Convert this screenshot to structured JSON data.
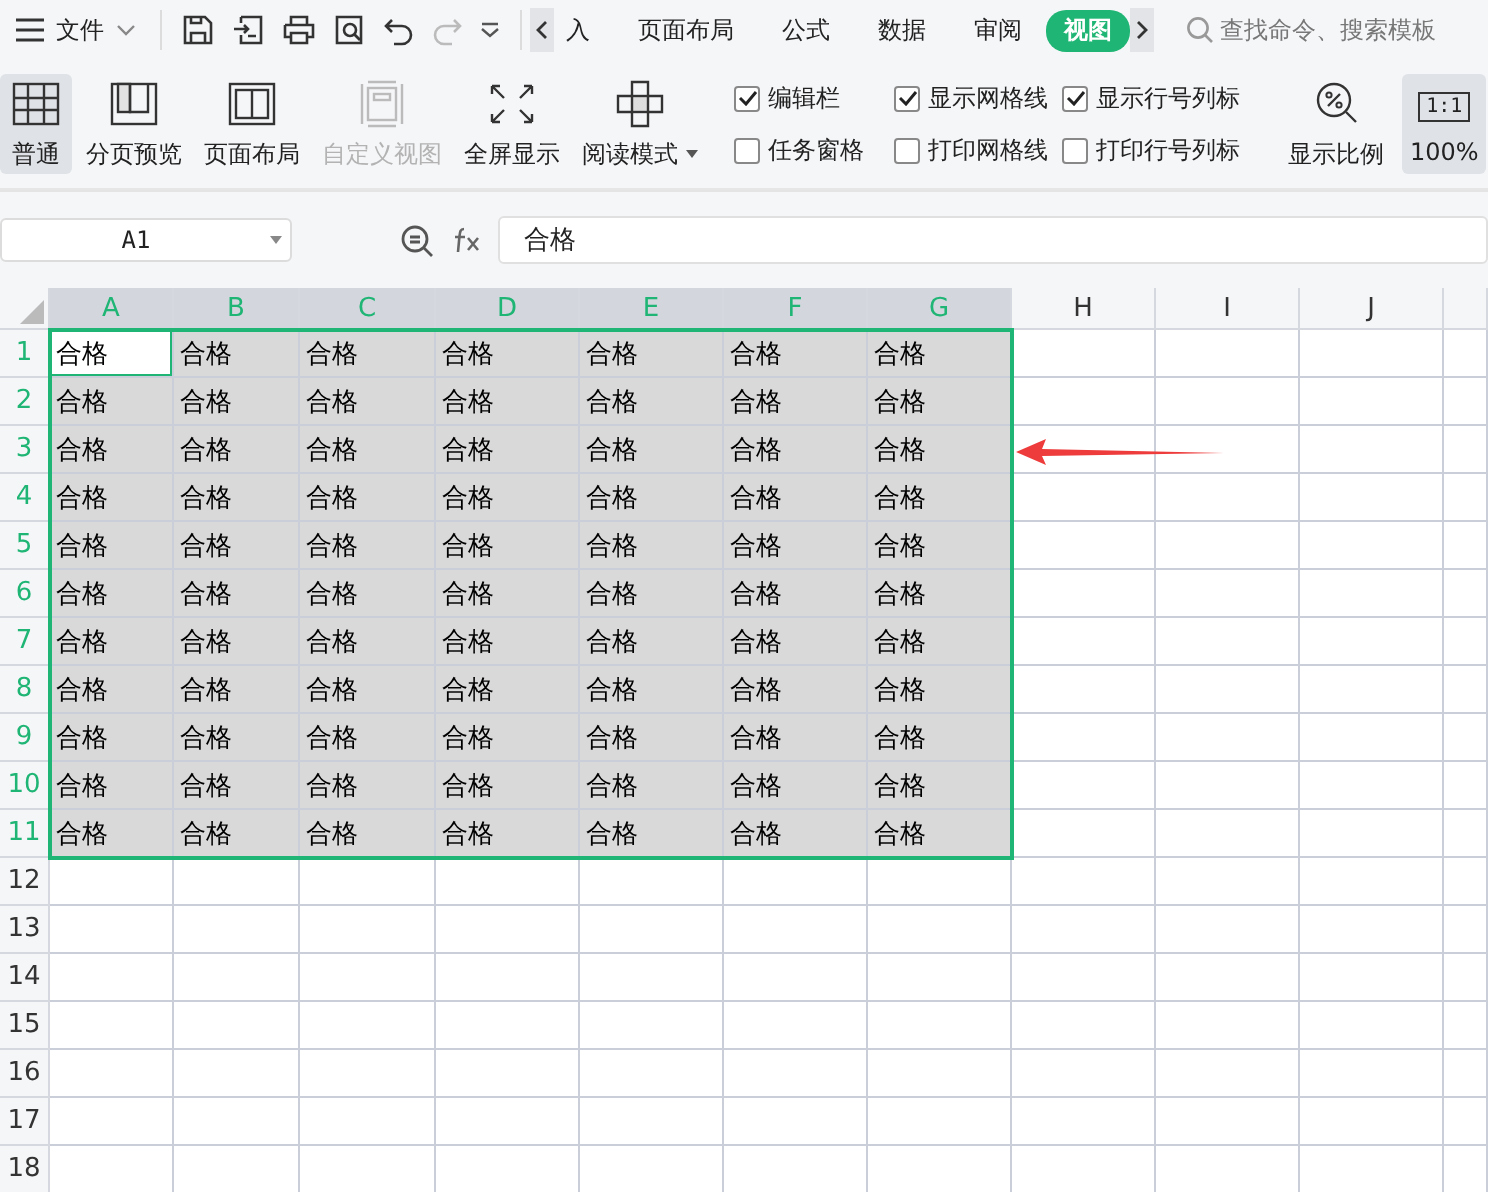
{
  "menu": {
    "label": "文件"
  },
  "tabs": [
    {
      "label": "入",
      "selected": false
    },
    {
      "label": "页面布局",
      "selected": false
    },
    {
      "label": "公式",
      "selected": false
    },
    {
      "label": "数据",
      "selected": false
    },
    {
      "label": "审阅",
      "selected": false
    },
    {
      "label": "视图",
      "selected": true
    }
  ],
  "search": {
    "placeholder": "查找命令、搜索模板"
  },
  "view_buttons": [
    {
      "label": "普通",
      "kind": "grid",
      "selected": true,
      "disabled": false
    },
    {
      "label": "分页预览",
      "kind": "pagebreak",
      "selected": false,
      "disabled": false
    },
    {
      "label": "页面布局",
      "kind": "layout",
      "selected": false,
      "disabled": false
    },
    {
      "label": "自定义视图",
      "kind": "custom",
      "selected": false,
      "disabled": true
    },
    {
      "label": "全屏显示",
      "kind": "fullscreen",
      "selected": false,
      "disabled": false
    },
    {
      "label": "阅读模式",
      "kind": "reading",
      "selected": false,
      "disabled": false
    }
  ],
  "checkboxes": [
    {
      "label": "编辑栏",
      "checked": true
    },
    {
      "label": "任务窗格",
      "checked": false
    },
    {
      "label": "显示网格线",
      "checked": true
    },
    {
      "label": "打印网格线",
      "checked": false
    },
    {
      "label": "显示行号列标",
      "checked": true
    },
    {
      "label": "打印行号列标",
      "checked": false
    }
  ],
  "zoom_buttons": [
    {
      "label": "显示比例",
      "kind": "zoom",
      "selected": false
    },
    {
      "label": "100%",
      "kind": "ratio",
      "icon_text": "1:1",
      "selected": true
    }
  ],
  "name_box": {
    "value": "A1"
  },
  "formula": {
    "value": "合格"
  },
  "columns": [
    {
      "label": "A",
      "selected": true
    },
    {
      "label": "B",
      "selected": true
    },
    {
      "label": "C",
      "selected": true
    },
    {
      "label": "D",
      "selected": true
    },
    {
      "label": "E",
      "selected": true
    },
    {
      "label": "F",
      "selected": true
    },
    {
      "label": "G",
      "selected": true
    },
    {
      "label": "H",
      "selected": false
    },
    {
      "label": "I",
      "selected": false
    },
    {
      "label": "J",
      "selected": false
    }
  ],
  "rows": [
    {
      "label": "1",
      "selected": true,
      "cells": [
        {
          "text": "合格",
          "active": true
        },
        {
          "text": "合格",
          "active": false
        },
        {
          "text": "合格",
          "active": false
        },
        {
          "text": "合格",
          "active": false
        },
        {
          "text": "合格",
          "active": false
        },
        {
          "text": "合格",
          "active": false
        },
        {
          "text": "合格",
          "active": false
        }
      ]
    },
    {
      "label": "2",
      "selected": true,
      "cells": [
        {
          "text": "合格",
          "active": false
        },
        {
          "text": "合格",
          "active": false
        },
        {
          "text": "合格",
          "active": false
        },
        {
          "text": "合格",
          "active": false
        },
        {
          "text": "合格",
          "active": false
        },
        {
          "text": "合格",
          "active": false
        },
        {
          "text": "合格",
          "active": false
        }
      ]
    },
    {
      "label": "3",
      "selected": true,
      "cells": [
        {
          "text": "合格",
          "active": false
        },
        {
          "text": "合格",
          "active": false
        },
        {
          "text": "合格",
          "active": false
        },
        {
          "text": "合格",
          "active": false
        },
        {
          "text": "合格",
          "active": false
        },
        {
          "text": "合格",
          "active": false
        },
        {
          "text": "合格",
          "active": false
        }
      ]
    },
    {
      "label": "4",
      "selected": true,
      "cells": [
        {
          "text": "合格",
          "active": false
        },
        {
          "text": "合格",
          "active": false
        },
        {
          "text": "合格",
          "active": false
        },
        {
          "text": "合格",
          "active": false
        },
        {
          "text": "合格",
          "active": false
        },
        {
          "text": "合格",
          "active": false
        },
        {
          "text": "合格",
          "active": false
        }
      ]
    },
    {
      "label": "5",
      "selected": true,
      "cells": [
        {
          "text": "合格",
          "active": false
        },
        {
          "text": "合格",
          "active": false
        },
        {
          "text": "合格",
          "active": false
        },
        {
          "text": "合格",
          "active": false
        },
        {
          "text": "合格",
          "active": false
        },
        {
          "text": "合格",
          "active": false
        },
        {
          "text": "合格",
          "active": false
        }
      ]
    },
    {
      "label": "6",
      "selected": true,
      "cells": [
        {
          "text": "合格",
          "active": false
        },
        {
          "text": "合格",
          "active": false
        },
        {
          "text": "合格",
          "active": false
        },
        {
          "text": "合格",
          "active": false
        },
        {
          "text": "合格",
          "active": false
        },
        {
          "text": "合格",
          "active": false
        },
        {
          "text": "合格",
          "active": false
        }
      ]
    },
    {
      "label": "7",
      "selected": true,
      "cells": [
        {
          "text": "合格",
          "active": false
        },
        {
          "text": "合格",
          "active": false
        },
        {
          "text": "合格",
          "active": false
        },
        {
          "text": "合格",
          "active": false
        },
        {
          "text": "合格",
          "active": false
        },
        {
          "text": "合格",
          "active": false
        },
        {
          "text": "合格",
          "active": false
        }
      ]
    },
    {
      "label": "8",
      "selected": true,
      "cells": [
        {
          "text": "合格",
          "active": false
        },
        {
          "text": "合格",
          "active": false
        },
        {
          "text": "合格",
          "active": false
        },
        {
          "text": "合格",
          "active": false
        },
        {
          "text": "合格",
          "active": false
        },
        {
          "text": "合格",
          "active": false
        },
        {
          "text": "合格",
          "active": false
        }
      ]
    },
    {
      "label": "9",
      "selected": true,
      "cells": [
        {
          "text": "合格",
          "active": false
        },
        {
          "text": "合格",
          "active": false
        },
        {
          "text": "合格",
          "active": false
        },
        {
          "text": "合格",
          "active": false
        },
        {
          "text": "合格",
          "active": false
        },
        {
          "text": "合格",
          "active": false
        },
        {
          "text": "合格",
          "active": false
        }
      ]
    },
    {
      "label": "10",
      "selected": true,
      "cells": [
        {
          "text": "合格",
          "active": false
        },
        {
          "text": "合格",
          "active": false
        },
        {
          "text": "合格",
          "active": false
        },
        {
          "text": "合格",
          "active": false
        },
        {
          "text": "合格",
          "active": false
        },
        {
          "text": "合格",
          "active": false
        },
        {
          "text": "合格",
          "active": false
        }
      ]
    },
    {
      "label": "11",
      "selected": true,
      "cells": [
        {
          "text": "合格",
          "active": false
        },
        {
          "text": "合格",
          "active": false
        },
        {
          "text": "合格",
          "active": false
        },
        {
          "text": "合格",
          "active": false
        },
        {
          "text": "合格",
          "active": false
        },
        {
          "text": "合格",
          "active": false
        },
        {
          "text": "合格",
          "active": false
        }
      ]
    },
    {
      "label": "12",
      "selected": false
    },
    {
      "label": "13",
      "selected": false
    },
    {
      "label": "14",
      "selected": false
    },
    {
      "label": "15",
      "selected": false
    },
    {
      "label": "16",
      "selected": false
    },
    {
      "label": "17",
      "selected": false
    },
    {
      "label": "18",
      "selected": false
    }
  ]
}
